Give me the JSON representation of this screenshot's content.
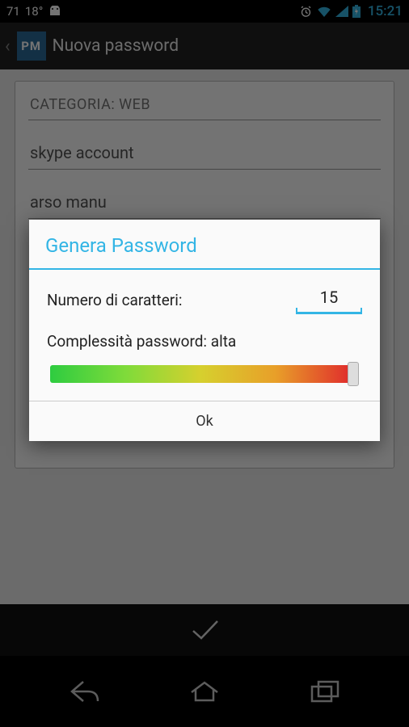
{
  "status": {
    "temp": "71",
    "deg": "18°",
    "time": "15:21"
  },
  "actionbar": {
    "title": "Nuova password",
    "logo": "PM"
  },
  "form": {
    "category_label": "CATEGORIA: WEB",
    "field1": "skype account",
    "field2": "arso manu"
  },
  "dialog": {
    "title": "Genera Password",
    "chars_label": "Numero di caratteri:",
    "chars_value": "15",
    "complexity_label": "Complessità password: alta",
    "ok": "Ok"
  }
}
